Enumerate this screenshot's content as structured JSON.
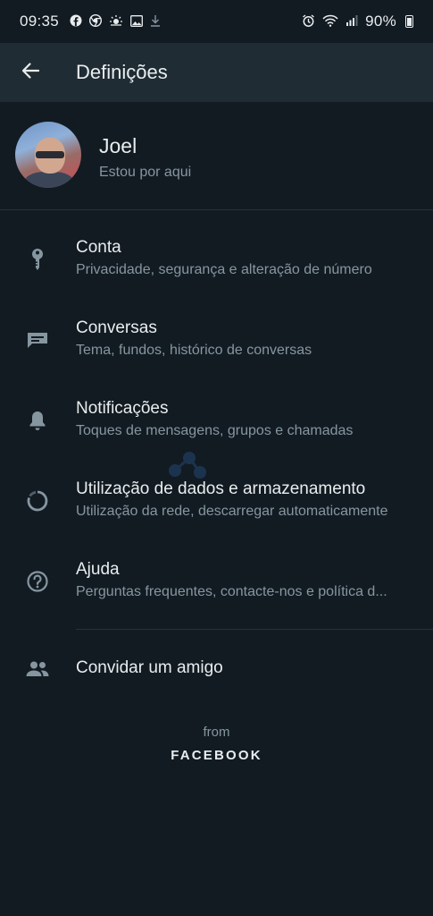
{
  "status_bar": {
    "time": "09:35",
    "battery": "90%",
    "left_icons": [
      "facebook-icon",
      "chrome-icon",
      "weather-icon",
      "gallery-icon",
      "download-icon"
    ],
    "right_icons": [
      "alarm-icon",
      "wifi-icon",
      "signal-icon",
      "battery-icon"
    ]
  },
  "app_bar": {
    "title": "Definições",
    "back_icon": "arrow-left-icon"
  },
  "profile": {
    "name": "Joel",
    "status": "Estou por aqui"
  },
  "menu": [
    {
      "icon": "key-icon",
      "title": "Conta",
      "subtitle": "Privacidade, segurança e alteração de número"
    },
    {
      "icon": "chat-icon",
      "title": "Conversas",
      "subtitle": "Tema, fundos, histórico de conversas"
    },
    {
      "icon": "bell-icon",
      "title": "Notificações",
      "subtitle": "Toques de mensagens, grupos e chamadas"
    },
    {
      "icon": "data-usage-icon",
      "title": "Utilização de dados e armazenamento",
      "subtitle": "Utilização da rede, descarregar automaticamente"
    },
    {
      "icon": "help-icon",
      "title": "Ajuda",
      "subtitle": "Perguntas frequentes, contacte-nos e política d..."
    }
  ],
  "invite": {
    "icon": "people-icon",
    "title": "Convidar um amigo"
  },
  "footer": {
    "from": "from",
    "brand": "FACEBOOK"
  },
  "colors": {
    "background": "#121b22",
    "app_bar": "#1f2c34",
    "primary_text": "#e9edef",
    "secondary_text": "#8696a0",
    "icon": "#8696a0"
  }
}
